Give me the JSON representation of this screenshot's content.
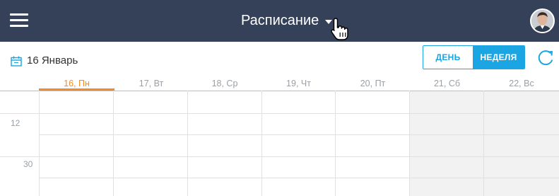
{
  "header": {
    "title": "Расписание",
    "menu_icon": "hamburger-menu-icon",
    "dropdown_icon": "caret-down-icon",
    "cursor_icon": "hand-pointer-cursor-icon",
    "avatar_icon": "user-avatar",
    "background_color": "#344159"
  },
  "toolbar": {
    "date_icon": "calendar-icon",
    "date_label": "16 Январь",
    "view_day_label": "ДЕНЬ",
    "view_week_label": "НЕДЕЛЯ",
    "active_view": "НЕДЕЛЯ",
    "refresh_icon": "refresh-icon",
    "accent_color": "#1ba5e2"
  },
  "calendar": {
    "days": [
      {
        "label": "16, Пн",
        "active": true
      },
      {
        "label": "17, Вт",
        "active": false
      },
      {
        "label": "18, Ср",
        "active": false
      },
      {
        "label": "19, Чт",
        "active": false
      },
      {
        "label": "20, Пт",
        "active": false
      },
      {
        "label": "21, Сб",
        "active": false,
        "weekend": true
      },
      {
        "label": "22, Вс",
        "active": false,
        "weekend": true
      }
    ],
    "time_labels": [
      "12",
      "30"
    ],
    "active_day_color": "#f28c28",
    "weekend_color": "#f2f2f2"
  }
}
